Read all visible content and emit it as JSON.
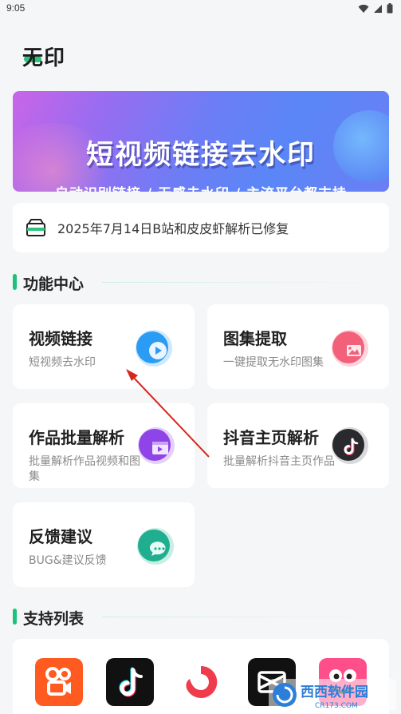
{
  "status_bar": {
    "time": "9:05"
  },
  "app_title": "无印",
  "banner": {
    "heading": "短视频链接去水印",
    "subheading": "自动识别链接 / 无感去水印 / 主流平台都支持"
  },
  "notice": {
    "text": "2025年7月14日B站和皮皮虾解析已修复"
  },
  "features_section": {
    "title": "功能中心"
  },
  "features": [
    {
      "title": "视频链接",
      "desc": "短视频去水印",
      "icon": "play-icon",
      "color": "#2b9cf3"
    },
    {
      "title": "图集提取",
      "desc": "一键提取无水印图集",
      "icon": "image-icon",
      "color": "#f2607a"
    },
    {
      "title": "作品批量解析",
      "desc": "批量解析作品视频和图集",
      "icon": "video-folder-icon",
      "color": "#8e44e6"
    },
    {
      "title": "抖音主页解析",
      "desc": "批量解析抖音主页作品",
      "icon": "tiktok-icon",
      "color": "#2a2a2e"
    },
    {
      "title": "反馈建议",
      "desc": "BUG&建议反馈",
      "icon": "chat-icon",
      "color": "#1fae8f"
    }
  ],
  "support_section": {
    "title": "支持列表"
  },
  "supported_apps": [
    {
      "name": "kuaishou-logo-icon",
      "color": "#ff5a1f"
    },
    {
      "name": "douyin-logo-icon",
      "color": "#111111"
    },
    {
      "name": "weishi-logo-icon",
      "color": "#f03b4d"
    },
    {
      "name": "capcut-logo-icon",
      "color": "#111111"
    },
    {
      "name": "pipixia-logo-icon",
      "color": "#ff4f8a"
    }
  ],
  "watermark": {
    "brand": "西西软件园",
    "site": "CR173.COM"
  }
}
